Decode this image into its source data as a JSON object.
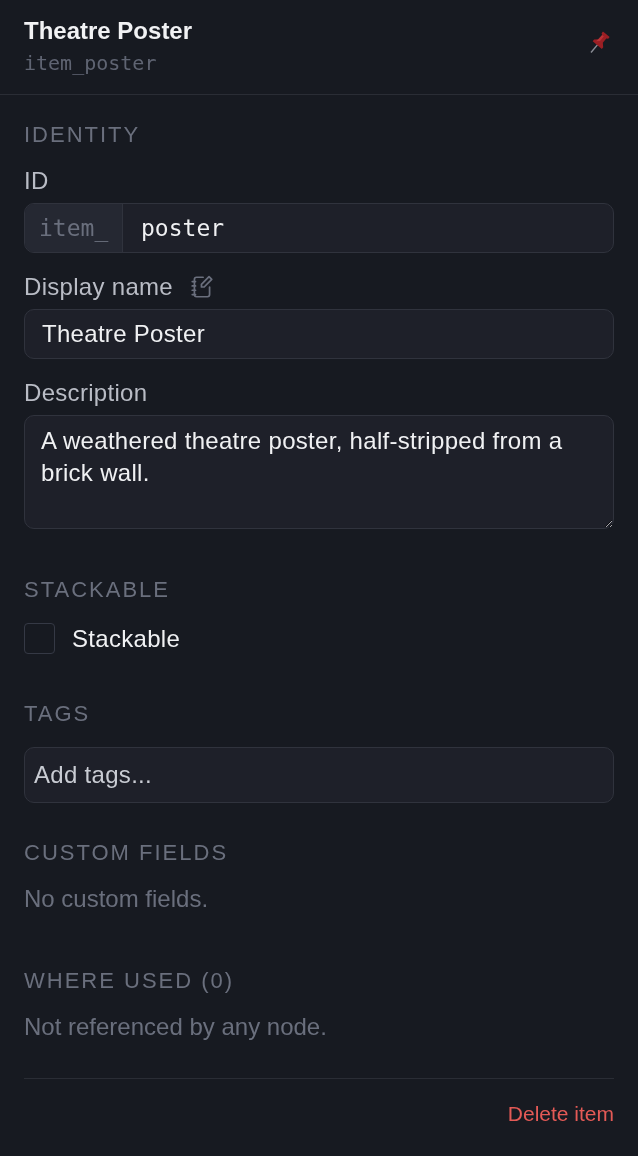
{
  "panel": {
    "title": "Theatre Poster",
    "subtitle": "item_poster"
  },
  "sections": [
    {
      "kind": "fields",
      "heading": "IDENTITY",
      "fields": [
        {
          "kind": "prefixed",
          "label": "ID",
          "input": {
            "prefix": "item_",
            "text": "poster"
          }
        },
        {
          "kind": "text",
          "label": "Display name",
          "value": "Theatre Poster"
        },
        {
          "kind": "textarea",
          "label": "Description",
          "value": "A weathered theatre poster, half-stripped from a brick wall."
        }
      ]
    },
    {
      "kind": "checks",
      "heading": "STACKABLE",
      "items": [
        {
          "label": "Stackable",
          "checked": false
        }
      ]
    },
    {
      "kind": "tags",
      "heading": "TAGS",
      "placeholder": "Add tags..."
    },
    {
      "kind": "empty",
      "heading": "CUSTOM FIELDS",
      "note": "No custom fields."
    },
    {
      "kind": "empty",
      "heading": "WHERE USED (0)",
      "note": "Not referenced by any node."
    }
  ],
  "footer": {
    "delete_label": "Delete item"
  }
}
